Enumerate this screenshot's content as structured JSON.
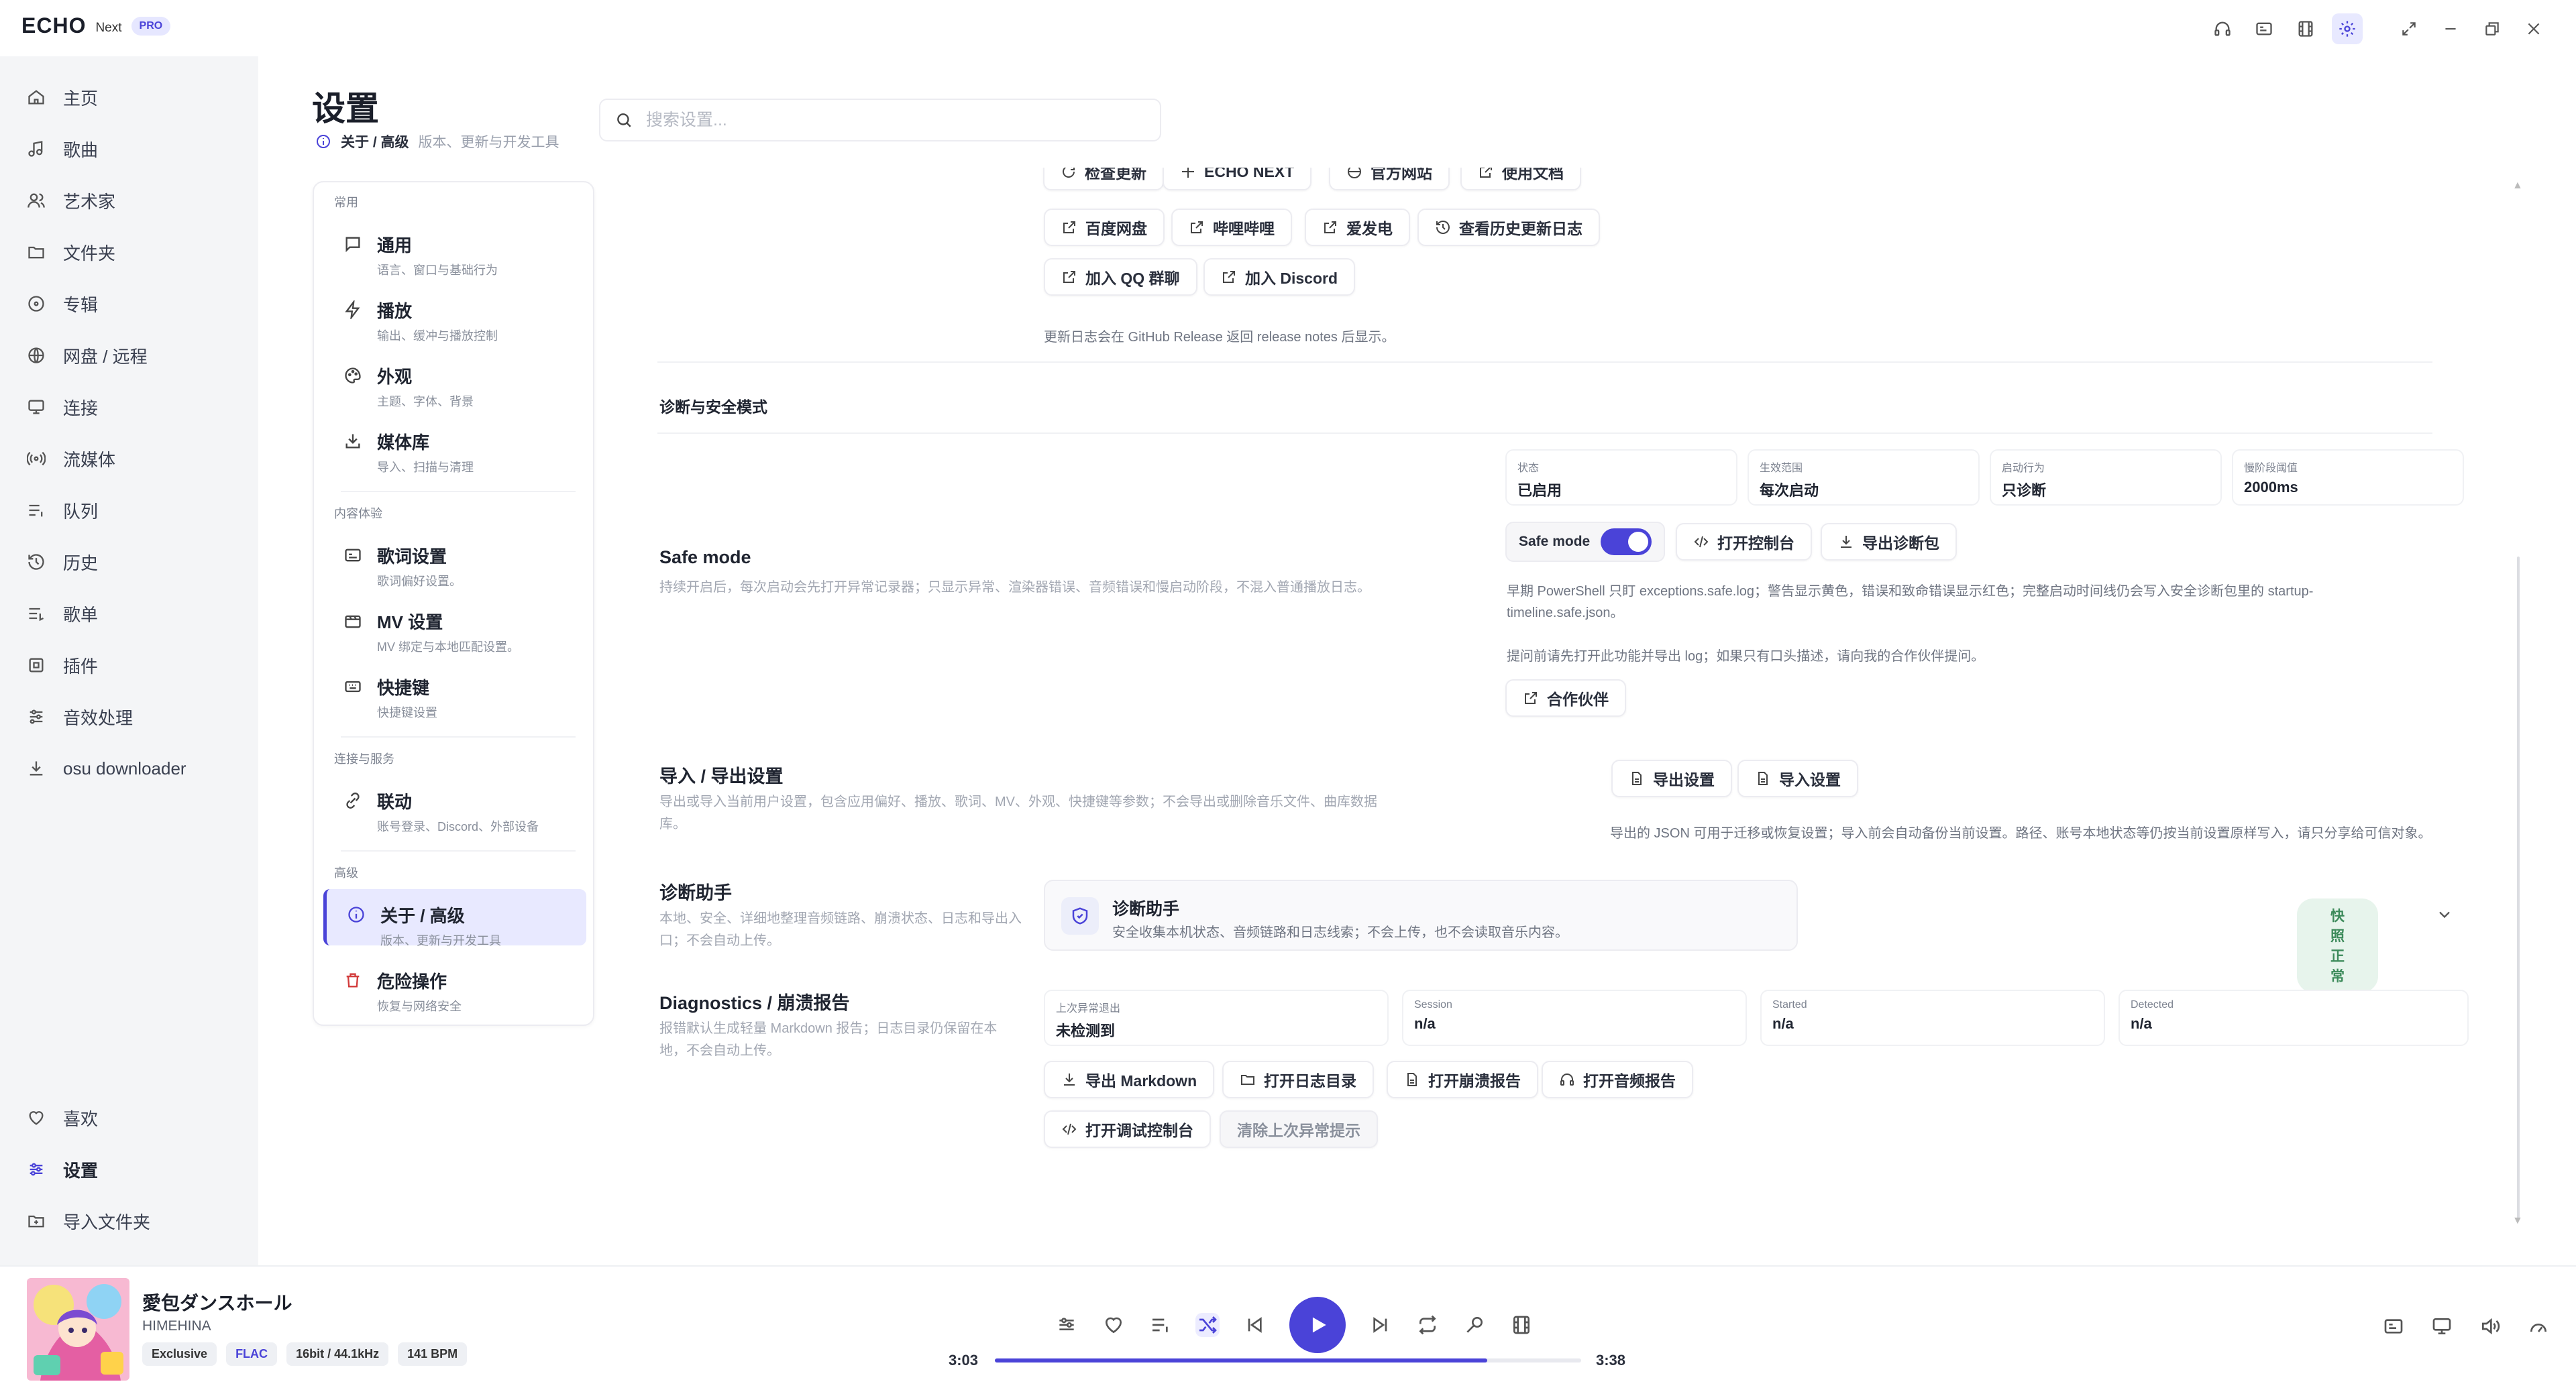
{
  "app": {
    "logo": "ECHO",
    "next": "Next",
    "pro": "PRO"
  },
  "titlebar_icons": [
    "headphones-icon",
    "lyrics-icon",
    "film-icon",
    "gear-icon",
    "expand-icon",
    "minimize-icon",
    "restore-icon",
    "close-icon"
  ],
  "sidebar": {
    "items": [
      {
        "label": "主页",
        "icon": "home-icon"
      },
      {
        "label": "歌曲",
        "icon": "music-note-icon"
      },
      {
        "label": "艺术家",
        "icon": "users-icon"
      },
      {
        "label": "文件夹",
        "icon": "folder-icon"
      },
      {
        "label": "专辑",
        "icon": "disc-icon"
      },
      {
        "label": "网盘 / 远程",
        "icon": "globe-icon"
      },
      {
        "label": "连接",
        "icon": "cast-icon"
      },
      {
        "label": "流媒体",
        "icon": "broadcast-icon"
      },
      {
        "label": "队列",
        "icon": "queue-icon"
      },
      {
        "label": "历史",
        "icon": "history-icon"
      },
      {
        "label": "歌单",
        "icon": "playlist-icon"
      },
      {
        "label": "插件",
        "icon": "plugin-icon"
      },
      {
        "label": "音效处理",
        "icon": "equalizer-icon"
      },
      {
        "label": "osu downloader",
        "icon": "download-icon"
      }
    ],
    "bottom": [
      {
        "label": "喜欢",
        "icon": "heart-icon"
      },
      {
        "label": "设置",
        "icon": "settings-sliders-icon"
      },
      {
        "label": "导入文件夹",
        "icon": "folder-plus-icon"
      }
    ]
  },
  "header": {
    "title": "设置",
    "crumb_main": "关于 / 高级",
    "crumb_sub": "版本、更新与开发工具",
    "search_placeholder": "搜索设置..."
  },
  "categories": {
    "groups": [
      {
        "title": "常用"
      },
      {
        "title": "内容体验"
      },
      {
        "title": "连接与服务"
      },
      {
        "title": "高级"
      }
    ],
    "items": [
      {
        "title": "通用",
        "sub": "语言、窗口与基础行为",
        "icon": "chat-icon"
      },
      {
        "title": "播放",
        "sub": "输出、缓冲与播放控制",
        "icon": "bolt-icon"
      },
      {
        "title": "外观",
        "sub": "主题、字体、背景",
        "icon": "palette-icon"
      },
      {
        "title": "媒体库",
        "sub": "导入、扫描与清理",
        "icon": "download-tray-icon"
      },
      {
        "title": "歌词设置",
        "sub": "歌词偏好设置。",
        "icon": "subtitle-icon"
      },
      {
        "title": "MV 设置",
        "sub": "MV 绑定与本地匹配设置。",
        "icon": "video-icon"
      },
      {
        "title": "快捷键",
        "sub": "快捷键设置",
        "icon": "keyboard-icon"
      },
      {
        "title": "联动",
        "sub": "账号登录、Discord、外部设备",
        "icon": "link-icon"
      },
      {
        "title": "关于 / 高级",
        "sub": "版本、更新与开发工具",
        "icon": "info-icon"
      },
      {
        "title": "危险操作",
        "sub": "恢复与网络安全",
        "icon": "trash-icon"
      }
    ]
  },
  "about": {
    "top_buttons": [
      "检查更新",
      "ECHO NEXT",
      "官方网站",
      "使用文档"
    ],
    "link_buttons": [
      "百度网盘",
      "哔哩哔哩",
      "爱发电",
      "查看历史更新日志"
    ],
    "community_buttons": [
      "加入 QQ 群聊",
      "加入 Discord"
    ],
    "changelog_note": "更新日志会在 GitHub Release 返回 release notes 后显示。"
  },
  "diagnostics_section": {
    "title": "诊断与安全模式"
  },
  "safe_mode": {
    "title": "Safe mode",
    "desc": "持续开启后，每次启动会先打开异常记录器；只显示异常、渲染器错误、音频错误和慢启动阶段，不混入普通播放日志。",
    "stats": [
      {
        "k": "状态",
        "v": "已启用"
      },
      {
        "k": "生效范围",
        "v": "每次启动"
      },
      {
        "k": "启动行为",
        "v": "只诊断"
      },
      {
        "k": "慢阶段阈值",
        "v": "2000ms"
      }
    ],
    "toggle_label": "Safe mode",
    "toggle_on": true,
    "btn_console": "打开控制台",
    "btn_export": "导出诊断包",
    "note1": "早期 PowerShell 只盯 exceptions.safe.log；警告显示黄色，错误和致命错误显示红色；完整启动时间线仍会写入安全诊断包里的 startup-timeline.safe.json。",
    "note2": "提问前请先打开此功能并导出 log；如果只有口头描述，请向我的合作伙伴提问。",
    "btn_partner": "合作伙伴"
  },
  "import_export": {
    "title": "导入 / 导出设置",
    "desc": "导出或导入当前用户设置，包含应用偏好、播放、歌词、MV、外观、快捷键等参数；不会导出或删除音乐文件、曲库数据库。",
    "btn_export": "导出设置",
    "btn_import": "导入设置",
    "note": "导出的 JSON 可用于迁移或恢复设置；导入前会自动备份当前设置。路径、账号本地状态等仍按当前设置原样写入，请只分享给可信对象。"
  },
  "diag_helper": {
    "title": "诊断助手",
    "desc": "本地、安全、详细地整理音频链路、崩溃状态、日志和导出入口；不会自动上传。",
    "card_title": "诊断助手",
    "card_desc": "安全收集本机状态、音频链路和日志线索；不会上传，也不会读取音乐内容。",
    "badge": "快照正常"
  },
  "crash": {
    "title": "Diagnostics / 崩溃报告",
    "desc": "报错默认生成轻量 Markdown 报告；日志目录仍保留在本地，不会自动上传。",
    "stats": [
      {
        "k": "上次异常退出",
        "v": "未检测到"
      },
      {
        "k": "Session",
        "v": "n/a"
      },
      {
        "k": "Started",
        "v": "n/a"
      },
      {
        "k": "Detected",
        "v": "n/a"
      }
    ],
    "buttons": [
      "导出 Markdown",
      "打开日志目录",
      "打开崩溃报告",
      "打开音频报告"
    ],
    "btn_debug": "打开调试控制台",
    "btn_clear": "清除上次异常提示"
  },
  "player": {
    "title": "愛包ダンスホール",
    "artist": "HIMEHINA",
    "tags": [
      "Exclusive",
      "FLAC",
      "16bit / 44.1kHz",
      "141 BPM"
    ],
    "current_time": "3:03",
    "total_time": "3:38",
    "progress": 0.84
  },
  "colors": {
    "accent": "#4a43d8",
    "accent_soft": "#e8e9ff",
    "ok": "#3c8a5a"
  }
}
